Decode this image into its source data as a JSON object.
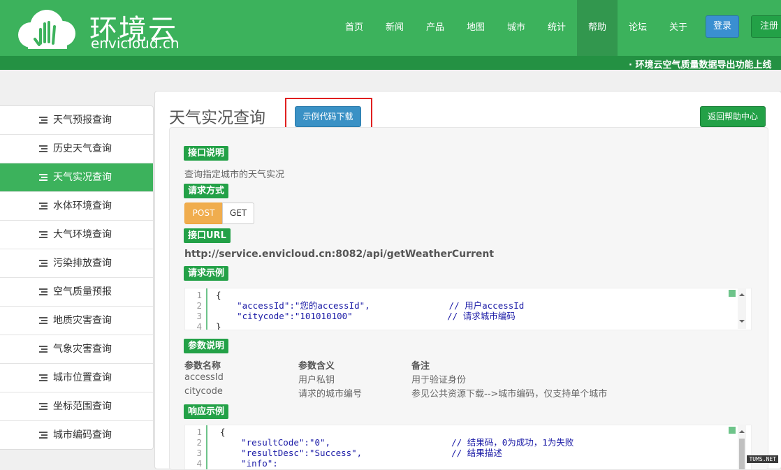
{
  "brand": {
    "cn": "环境云",
    "en": "envicloud.cn"
  },
  "nav": [
    "首页",
    "新闻",
    "产品",
    "地图",
    "城市",
    "统计",
    "帮助",
    "论坛",
    "关于"
  ],
  "nav_active": "帮助",
  "auth": {
    "login": "登录",
    "register": "注册"
  },
  "ticker": "· 环境云空气质量数据导出功能上线",
  "sidebar": [
    "天气预报查询",
    "历史天气查询",
    "天气实况查询",
    "水体环境查询",
    "大气环境查询",
    "污染排放查询",
    "空气质量预报",
    "地质灾害查询",
    "气象灾害查询",
    "城市位置查询",
    "坐标范围查询",
    "城市编码查询"
  ],
  "sidebar_active": "天气实况查询",
  "page": {
    "title": "天气实况查询",
    "download_button": "示例代码下载",
    "back_button": "返回帮助中心"
  },
  "sections": {
    "desc_label": "接口说明",
    "desc_text": "查询指定城市的天气实况",
    "method_label": "请求方式",
    "method_post": "POST",
    "method_get": "GET",
    "url_label": "接口URL",
    "url": "http://service.envicloud.cn:8082/api/getWeatherCurrent",
    "request_label": "请求示例",
    "params_label": "参数说明",
    "response_label": "响应示例"
  },
  "params": {
    "headers": [
      "参数名称",
      "参数含义",
      "备注"
    ],
    "rows": [
      [
        "accessId",
        "用户私钥",
        "用于验证身份"
      ],
      [
        "citycode",
        "请求的城市编号",
        "参见公共资源下载-->城市编码，仅支持单个城市"
      ]
    ]
  },
  "request_code": [
    {
      "n": "1",
      "t": "{"
    },
    {
      "n": "2",
      "t": "    \"accessId\":\"您的accessId\",               // 用户accessId"
    },
    {
      "n": "3",
      "t": "    \"citycode\":\"101010100\"                  // 请求城市编码"
    },
    {
      "n": "4",
      "t": "}"
    }
  ],
  "response_code": [
    {
      "n": "1",
      "t": "{"
    },
    {
      "n": "2",
      "t": "    \"resultCode\":\"0\",                       // 结果码，0为成功，1为失败"
    },
    {
      "n": "3",
      "t": "    \"resultDesc\":\"Success\",                 // 结果描述"
    },
    {
      "n": "4",
      "t": "    \"info\":"
    }
  ],
  "watermark": "TUMS.NET"
}
